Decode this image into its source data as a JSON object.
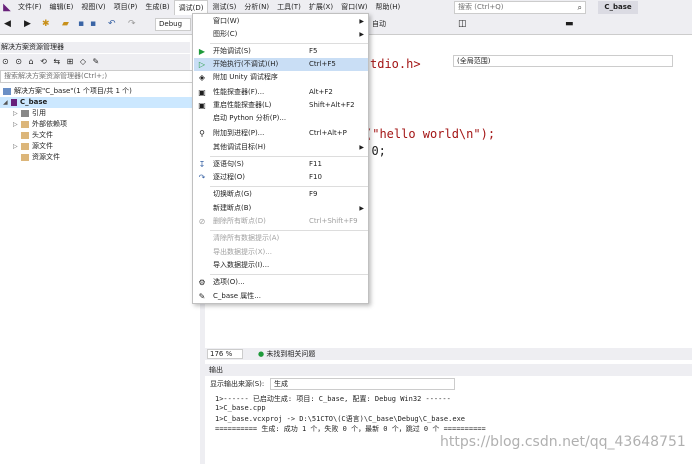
{
  "menubar": {
    "items": [
      "文件(F)",
      "编辑(E)",
      "视图(V)",
      "项目(P)",
      "生成(B)",
      "调试(D)",
      "测试(S)",
      "分析(N)",
      "工具(T)",
      "扩展(X)",
      "窗口(W)",
      "帮助(H)"
    ],
    "search_placeholder": "搜索 (Ctrl+Q)",
    "solution_tab": "C_base"
  },
  "toolbar": {
    "config": "Debug",
    "run_mode": "自动"
  },
  "solution_explorer": {
    "title": "解决方案资源管理器",
    "search_placeholder": "搜索解决方案资源管理器(Ctrl+;)",
    "tree": [
      {
        "label": "解决方案\"C_base\"(1 个项目/共 1 个)"
      },
      {
        "label": "C_base"
      },
      {
        "label": "引用"
      },
      {
        "label": "外部依赖项"
      },
      {
        "label": "头文件"
      },
      {
        "label": "源文件"
      },
      {
        "label": "资源文件"
      }
    ]
  },
  "editor": {
    "scope": "(全局范围)",
    "lines": [
      "tdio.h>",
      "(\"hello world\\n\");",
      "n 0;"
    ]
  },
  "status": {
    "zoom": "176 %",
    "issues": "未找到相关问题"
  },
  "output": {
    "title": "输出",
    "source_label": "显示输出来源(S):",
    "source_value": "生成",
    "lines": [
      "1>------ 已启动生成: 项目: C_base, 配置: Debug Win32 ------",
      "1>C_base.cpp",
      "1>C_base.vcxproj -> D:\\51CTO\\(C语言)\\C_base\\Debug\\C_base.exe",
      "========== 生成: 成功 1 个，失败 0 个，最新 0 个，跳过 0 个 =========="
    ]
  },
  "debug_menu": {
    "items": [
      {
        "label": "窗口(W)",
        "key": "",
        "icon": ""
      },
      {
        "label": "图形(C)",
        "key": "",
        "icon": ""
      },
      {
        "label": "开始调试(S)",
        "key": "F5",
        "icon": "play-icon"
      },
      {
        "label": "开始执行(不调试)(H)",
        "key": "Ctrl+F5",
        "icon": "play-outline-icon"
      },
      {
        "label": "附加 Unity 调试程序",
        "key": "",
        "icon": "unity-icon"
      },
      {
        "label": "性能探查器(F)...",
        "key": "Alt+F2",
        "icon": "profiler-icon"
      },
      {
        "label": "重启性能探查器(L)",
        "key": "Shift+Alt+F2",
        "icon": "profiler-restart-icon"
      },
      {
        "label": "启动 Python 分析(P)...",
        "key": "",
        "icon": ""
      },
      {
        "label": "附加到进程(P)...",
        "key": "Ctrl+Alt+P",
        "icon": "attach-icon"
      },
      {
        "label": "其他调试目标(H)",
        "key": "",
        "icon": ""
      },
      {
        "label": "逐语句(S)",
        "key": "F11",
        "icon": "step-into-icon"
      },
      {
        "label": "逐过程(O)",
        "key": "F10",
        "icon": "step-over-icon"
      },
      {
        "label": "切换断点(G)",
        "key": "F9",
        "icon": ""
      },
      {
        "label": "新建断点(B)",
        "key": "",
        "icon": ""
      },
      {
        "label": "删除所有断点(D)",
        "key": "Ctrl+Shift+F9",
        "icon": "delete-breakpoints-icon"
      },
      {
        "label": "清除所有数据提示(A)",
        "key": "",
        "icon": ""
      },
      {
        "label": "导出数据提示(X)...",
        "key": "",
        "icon": ""
      },
      {
        "label": "导入数据提示(I)...",
        "key": "",
        "icon": ""
      },
      {
        "label": "选项(O)...",
        "key": "",
        "icon": "gear-icon"
      },
      {
        "label": "C_base 属性...",
        "key": "",
        "icon": "wrench-icon"
      }
    ]
  },
  "watermark": "https://blog.csdn.net/qq_43648751"
}
